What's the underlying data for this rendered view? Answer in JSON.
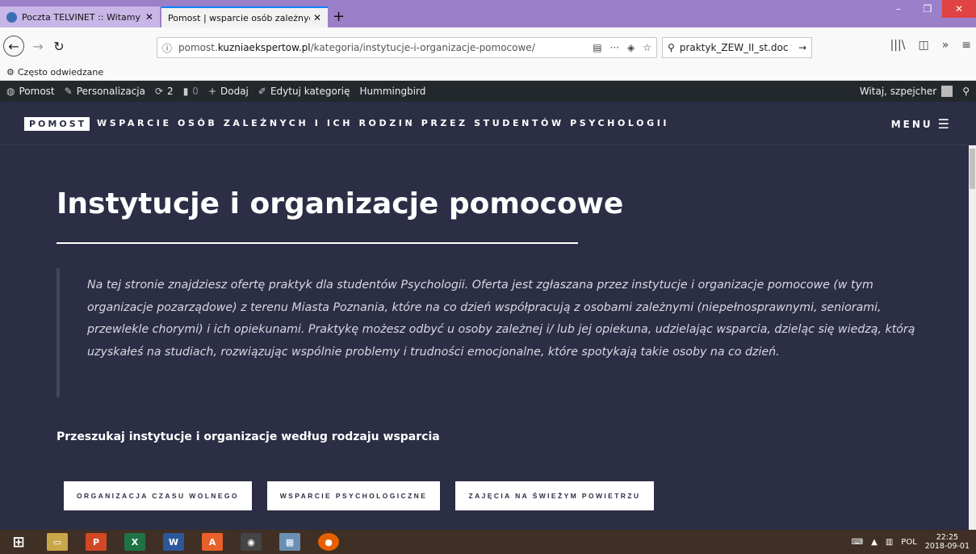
{
  "browser": {
    "tabs": [
      {
        "title": "Poczta TELVINET :: Witamy w P"
      },
      {
        "title": "Pomost | wsparcie osób zależnych i"
      }
    ],
    "url_prefix": "pomost.",
    "url_domain": "kuzniaekspertow.pl",
    "url_path": "/kategoria/instytucje-i-organizacje-pomocowe/",
    "search_value": "praktyk_ZEW_II_st.doc",
    "bookmark": "Często odwiedzane"
  },
  "adminbar": {
    "site": "Pomost",
    "customize": "Personalizacja",
    "updates": "2",
    "comments": "0",
    "new": "Dodaj",
    "edit": "Edytuj kategorię",
    "hummingbird": "Hummingbird",
    "greeting": "Witaj, szpejcher"
  },
  "header": {
    "logo": "POMOST",
    "tagline": "WSPARCIE OSÓB ZALEŻNYCH I ICH RODZIN PRZEZ STUDENTÓW PSYCHOLOGII",
    "menu": "MENU"
  },
  "main": {
    "title": "Instytucje i organizacje pomocowe",
    "quote": "Na tej stronie znajdziesz ofertę praktyk dla studentów Psychologii. Oferta jest zgłaszana przez instytucje i organizacje pomocowe (w tym organizacje pozarządowe) z terenu Miasta Poznania, które na co dzień współpracują z osobami zależnymi (niepełnosprawnymi, seniorami, przewlekle chorymi) i ich opiekunami. Praktykę możesz odbyć u osoby zależnej i/ lub jej opiekuna, udzielając wsparcia, dzieląc się wiedzą, którą uzyskałeś na studiach, rozwiązując wspólnie problemy i trudności emocjonalne, które spotykają takie osoby na co dzień.",
    "filter_heading": "Przeszukaj instytucje i organizacje według rodzaju wsparcia",
    "filters": [
      "ORGANIZACJA CZASU WOLNEGO",
      "WSPARCIE PSYCHOLOGICZNE",
      "ZAJĘCIA NA ŚWIEŻYM POWIETRZU"
    ]
  },
  "taskbar": {
    "lang": "POL",
    "time": "22:25",
    "date": "2018-09-01"
  }
}
